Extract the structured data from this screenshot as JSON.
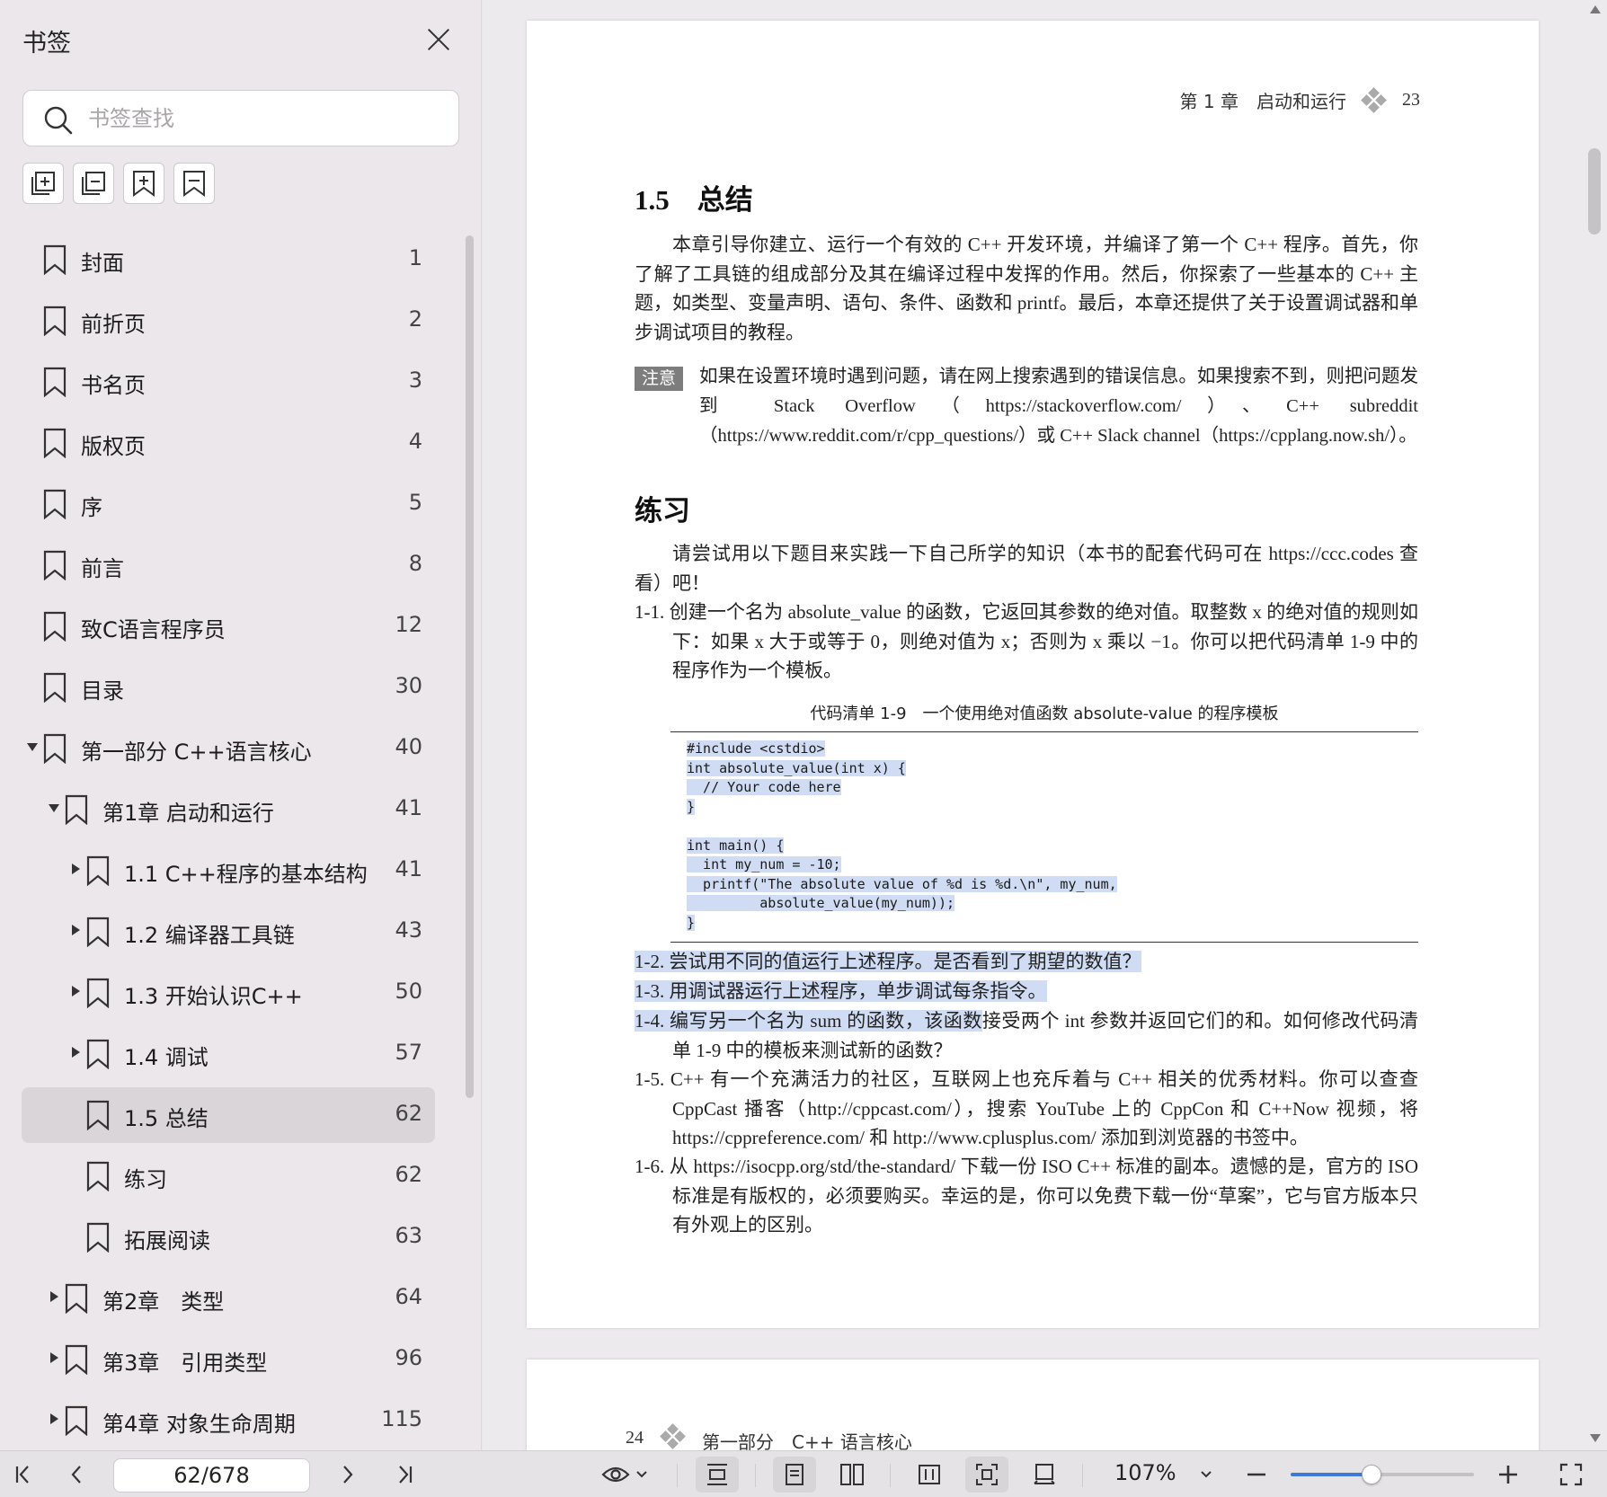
{
  "sidebar": {
    "title": "书签",
    "search_placeholder": "书签查找",
    "tools": [
      "expand-all-icon",
      "collapse-all-icon",
      "add-bookmark-icon",
      "bookmark-page-icon"
    ],
    "bookmarks": [
      {
        "label": "封面",
        "page": "1",
        "level": 0,
        "toggle": "none"
      },
      {
        "label": "前折页",
        "page": "2",
        "level": 0,
        "toggle": "none"
      },
      {
        "label": "书名页",
        "page": "3",
        "level": 0,
        "toggle": "none"
      },
      {
        "label": "版权页",
        "page": "4",
        "level": 0,
        "toggle": "none"
      },
      {
        "label": "序",
        "page": "5",
        "level": 0,
        "toggle": "none"
      },
      {
        "label": "前言",
        "page": "8",
        "level": 0,
        "toggle": "none"
      },
      {
        "label": "致C语言程序员",
        "page": "12",
        "level": 0,
        "toggle": "none"
      },
      {
        "label": "目录",
        "page": "30",
        "level": 0,
        "toggle": "none"
      },
      {
        "label": "第一部分 C++语言核心",
        "page": "40",
        "level": 0,
        "toggle": "expanded"
      },
      {
        "label": "第1章 启动和运行",
        "page": "41",
        "level": 1,
        "toggle": "expanded"
      },
      {
        "label": "1.1 C++程序的基本结构",
        "page": "41",
        "level": 2,
        "toggle": "collapsed"
      },
      {
        "label": "1.2 编译器工具链",
        "page": "43",
        "level": 2,
        "toggle": "collapsed"
      },
      {
        "label": "1.3 开始认识C++",
        "page": "50",
        "level": 2,
        "toggle": "collapsed"
      },
      {
        "label": "1.4 调试",
        "page": "57",
        "level": 2,
        "toggle": "collapsed"
      },
      {
        "label": "1.5 总结",
        "page": "62",
        "level": 2,
        "toggle": "none",
        "active": true
      },
      {
        "label": "练习",
        "page": "62",
        "level": 2,
        "toggle": "none"
      },
      {
        "label": "拓展阅读",
        "page": "63",
        "level": 2,
        "toggle": "none"
      },
      {
        "label": "第2章　类型",
        "page": "64",
        "level": 1,
        "toggle": "collapsed"
      },
      {
        "label": "第3章　引用类型",
        "page": "96",
        "level": 1,
        "toggle": "collapsed"
      },
      {
        "label": "第4章 对象生命周期",
        "page": "115",
        "level": 1,
        "toggle": "collapsed"
      }
    ]
  },
  "page23": {
    "running_head": "第 1 章　启动和运行",
    "page_number": "23",
    "section_heading": "1.5　总结",
    "summary": "本章引导你建立、运行一个有效的 C++ 开发环境，并编译了第一个 C++ 程序。首先，你了解了工具链的组成部分及其在编译过程中发挥的作用。然后，你探索了一些基本的 C++ 主题，如类型、变量声明、语句、条件、函数和 printf。最后，本章还提供了关于设置调试器和单步调试项目的教程。",
    "note_tag": "注意",
    "note_text": "如果在设置环境时遇到问题，请在网上搜索遇到的错误信息。如果搜索不到，则把问题发到 Stack Overflow（https://stackoverflow.com/）、C++ subreddit（https://www.reddit.com/r/cpp_questions/）或 C++ Slack channel（https://cpplang.now.sh/）。",
    "exercises_heading": "练习",
    "exercises_intro": "请尝试用以下题目来实践一下自己所学的知识（本书的配套代码可在 https://ccc.codes 查看）吧！",
    "ex_1_1": "1-1. 创建一个名为 absolute_value 的函数，它返回其参数的绝对值。取整数 x 的绝对值的规则如下：如果 x 大于或等于 0，则绝对值为 x；否则为 x 乘以 −1。你可以把代码清单 1-9 中的程序作为一个模板。",
    "listing_caption": "代码清单 1-9　一个使用绝对值函数 absolute-value 的程序模板",
    "code_lines": [
      "#include <cstdio>",
      "int absolute_value(int x) {",
      "  // Your code here",
      "}",
      "",
      "int main() {",
      "  int my_num = -10;",
      "  printf(\"The absolute value of %d is %d.\\n\", my_num,",
      "         absolute_value(my_num));",
      "}"
    ],
    "ex_1_2": "1-2. 尝试用不同的值运行上述程序。是否看到了期望的数值？",
    "ex_1_3": "1-3. 用调试器运行上述程序，单步调试每条指令。",
    "ex_1_4_hl": "1-4. 编写另一个名为 sum 的函数，该函数",
    "ex_1_4_rest": "接受两个 int 参数并返回它们的和。如何修改代码清单 1-9 中的模板来测试新的函数？",
    "ex_1_5": "1-5. C++ 有一个充满活力的社区，互联网上也充斥着与 C++ 相关的优秀材料。你可以查查 CppCast 播客（http://cppcast.com/），搜索 YouTube 上的 CppCon 和 C++Now 视频，将 https://cppreference.com/ 和 http://www.cplusplus.com/ 添加到浏览器的书签中。",
    "ex_1_6": "1-6. 从 https://isocpp.org/std/the-standard/ 下载一份 ISO C++ 标准的副本。遗憾的是，官方的 ISO 标准是有版权的，必须要购买。幸运的是，你可以免费下载一份“草案”，它与官方版本只有外观上的区别。"
  },
  "page24": {
    "page_number": "24",
    "running_head": "第一部分　C++ 语言核心"
  },
  "toolbar": {
    "page_indicator": "62/678",
    "zoom": "107%",
    "zoom_fraction": 0.44,
    "accent": "#3d7ad6"
  }
}
